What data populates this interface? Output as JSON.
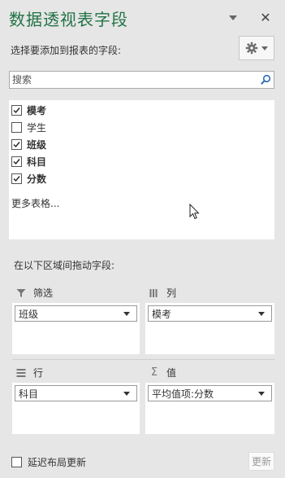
{
  "panel": {
    "title": "数据透视表字段",
    "choose_label": "选择要添加到报表的字段:",
    "search_placeholder": "搜索"
  },
  "fields": [
    {
      "label": "模考",
      "checked": true
    },
    {
      "label": "学生",
      "checked": false
    },
    {
      "label": "班级",
      "checked": true
    },
    {
      "label": "科目",
      "checked": true
    },
    {
      "label": "分数",
      "checked": true
    }
  ],
  "more_tables": "更多表格...",
  "drag_label": "在以下区域间拖动字段:",
  "areas": {
    "filters": {
      "title": "筛选",
      "icon": "filter-icon",
      "item": "班级"
    },
    "columns": {
      "title": "列",
      "icon": "columns-icon",
      "item": "模考"
    },
    "rows": {
      "title": "行",
      "icon": "rows-icon",
      "item": "科目"
    },
    "values": {
      "title": "值",
      "icon": "sigma-icon",
      "item": "平均值项:分数"
    }
  },
  "footer": {
    "defer_label": "延迟布局更新",
    "defer_checked": false,
    "update_label": "更新"
  },
  "colors": {
    "title": "#217346",
    "panel_bg": "#e6e6e6"
  }
}
